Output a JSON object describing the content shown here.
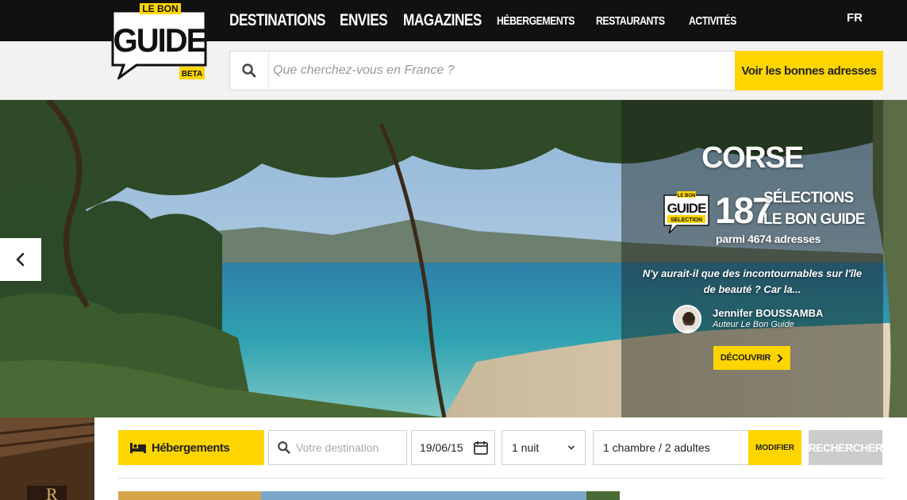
{
  "logo": {
    "line1": "LE BON",
    "line2": "GUIDE",
    "tag": "BETA"
  },
  "nav": {
    "items": [
      {
        "label": "DESTINATIONS",
        "size": "big"
      },
      {
        "label": "ENVIES",
        "size": "big"
      },
      {
        "label": "MAGAZINES",
        "size": "big"
      },
      {
        "label": "HÉBERGEMENTS",
        "size": "small"
      },
      {
        "label": "RESTAURANTS",
        "size": "small"
      },
      {
        "label": "ACTIVITÉS",
        "size": "small"
      }
    ],
    "lang": "FR"
  },
  "search": {
    "placeholder": "Que cherchez-vous en France ?",
    "button": "Voir les bonnes adresses",
    "icon": "search-icon"
  },
  "hero": {
    "title": "CORSE",
    "count": "187",
    "selections_line1": "SÉLECTIONS",
    "selections_line2": "LE BON GUIDE",
    "among": "parmi 4674 adresses",
    "badge": {
      "line1": "LE BON",
      "line2": "GUIDE",
      "line3": "SELECTION"
    },
    "teaser": "N'y aurait-il que des incontournables sur l'île de beauté ? Car la...",
    "author": "Jennifer BOUSSAMBA",
    "author_role": "Auteur Le Bon Guide",
    "cta": "DÉCOUVRIR"
  },
  "booking": {
    "type": "Hébergements",
    "destination_placeholder": "Votre destination",
    "date": "19/06/15",
    "nights": "1 nuit",
    "rooms": "1 chambre / 2 adultes",
    "modify": "MODIFIER",
    "search": "RECHERCHER"
  },
  "colors": {
    "accent": "#ffd500",
    "nav_bg": "#111111"
  }
}
